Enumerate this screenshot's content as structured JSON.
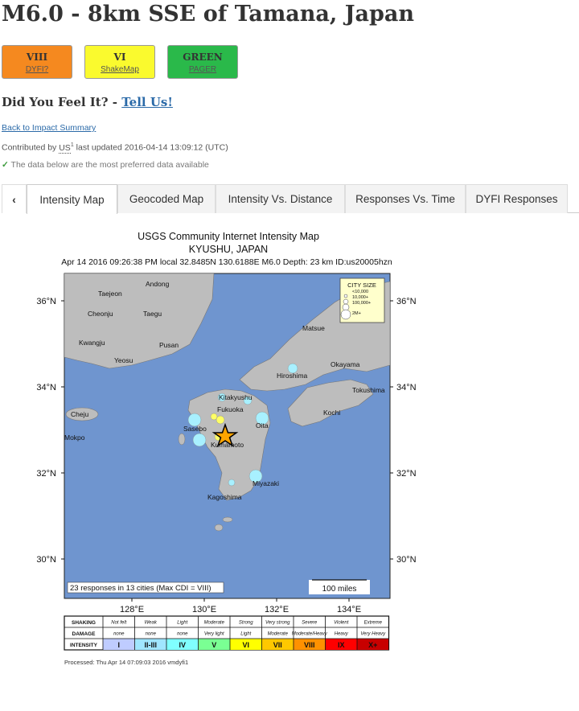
{
  "title": "M6.0 - 8km SSE of Tamana, Japan",
  "badges": [
    {
      "level": "VIII",
      "label": "DYFI?",
      "color": "#f5891f"
    },
    {
      "level": "VI",
      "label": "ShakeMap",
      "color": "#fafa2e"
    },
    {
      "level": "GREEN",
      "label": "PAGER",
      "color": "#2ab94a"
    }
  ],
  "dyfi": {
    "question": "Did You Feel It? -",
    "link": "Tell Us!"
  },
  "back_link": "Back to Impact Summary",
  "contributed": {
    "prefix": "Contributed by",
    "network": "US",
    "sup": "1",
    "updated": "last updated 2016-04-14 13:09:12 (UTC)"
  },
  "preferred": "The data below are the most preferred data available",
  "tabs": [
    "Intensity Map",
    "Geocoded Map",
    "Intensity Vs. Distance",
    "Responses Vs. Time",
    "DYFI Responses"
  ],
  "map": {
    "title": "USGS Community Internet Intensity Map",
    "region": "KYUSHU, JAPAN",
    "event_line": "Apr 14 2016 09:26:38 PM local 32.8485N 130.6188E M6.0 Depth: 23 km ID:us20005hzn",
    "lat_labels": [
      "36°N",
      "34°N",
      "32°N",
      "30°N"
    ],
    "lon_labels": [
      "128°E",
      "130°E",
      "132°E",
      "134°E"
    ],
    "cities": [
      "Andong",
      "Taejeon",
      "Cheonju",
      "Taegu",
      "Kwangju",
      "Pusan",
      "Yeosu",
      "Matsue",
      "Hiroshima",
      "Okayama",
      "Kitakyushu",
      "Tokushima",
      "Cheju",
      "Fukuoka",
      "Kochi",
      "Oita",
      "Sasebo",
      "Mokpo",
      "Kumamoto",
      "Miyazaki",
      "Kagoshima"
    ],
    "city_size": {
      "title": "CITY SIZE",
      "items": [
        "<10,000",
        "10,000+",
        "100,000+",
        "2M+"
      ]
    },
    "responses_note": "23 responses in 13 cities (Max CDI = VIII)",
    "scale_label": "100 miles",
    "processed": "Processed: Thu Apr 14 07:09:03 2016 vmdyfi1"
  },
  "legend": {
    "rows": [
      "SHAKING",
      "DAMAGE",
      "INTENSITY"
    ],
    "shaking": [
      "Not felt",
      "Weak",
      "Light",
      "Moderate",
      "Strong",
      "Very strong",
      "Severe",
      "Violent",
      "Extreme"
    ],
    "damage": [
      "none",
      "none",
      "none",
      "Very light",
      "Light",
      "Moderate",
      "Moderate/Heavy",
      "Heavy",
      "Very Heavy"
    ],
    "intensity": [
      "I",
      "II-III",
      "IV",
      "V",
      "VI",
      "VII",
      "VIII",
      "IX",
      "X+"
    ],
    "colors": [
      "#ffffff",
      "#bfccff",
      "#a0e6ff",
      "#80ffff",
      "#7aff93",
      "#ffff00",
      "#ffc800",
      "#ff9100",
      "#ff0000",
      "#c80000"
    ]
  }
}
